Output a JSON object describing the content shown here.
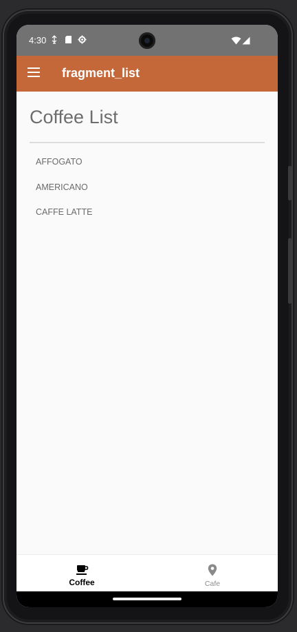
{
  "status_bar": {
    "time": "4:30",
    "left_icons": [
      "usb-debug-icon",
      "sd-card-icon",
      "settings-gear-icon"
    ],
    "right_icons": [
      "wifi-icon",
      "cell-signal-icon"
    ]
  },
  "app_bar": {
    "title": "fragment_list",
    "menu_icon": "hamburger-menu-icon",
    "color": "#c4683a"
  },
  "main": {
    "title": "Coffee List",
    "items": [
      {
        "label": "AFFOGATO"
      },
      {
        "label": "AMERICANO"
      },
      {
        "label": "CAFFE LATTE"
      }
    ]
  },
  "bottom_nav": {
    "items": [
      {
        "label": "Coffee",
        "icon": "coffee-cup-icon",
        "active": true
      },
      {
        "label": "Cafe",
        "icon": "location-pin-icon",
        "active": false
      }
    ]
  }
}
